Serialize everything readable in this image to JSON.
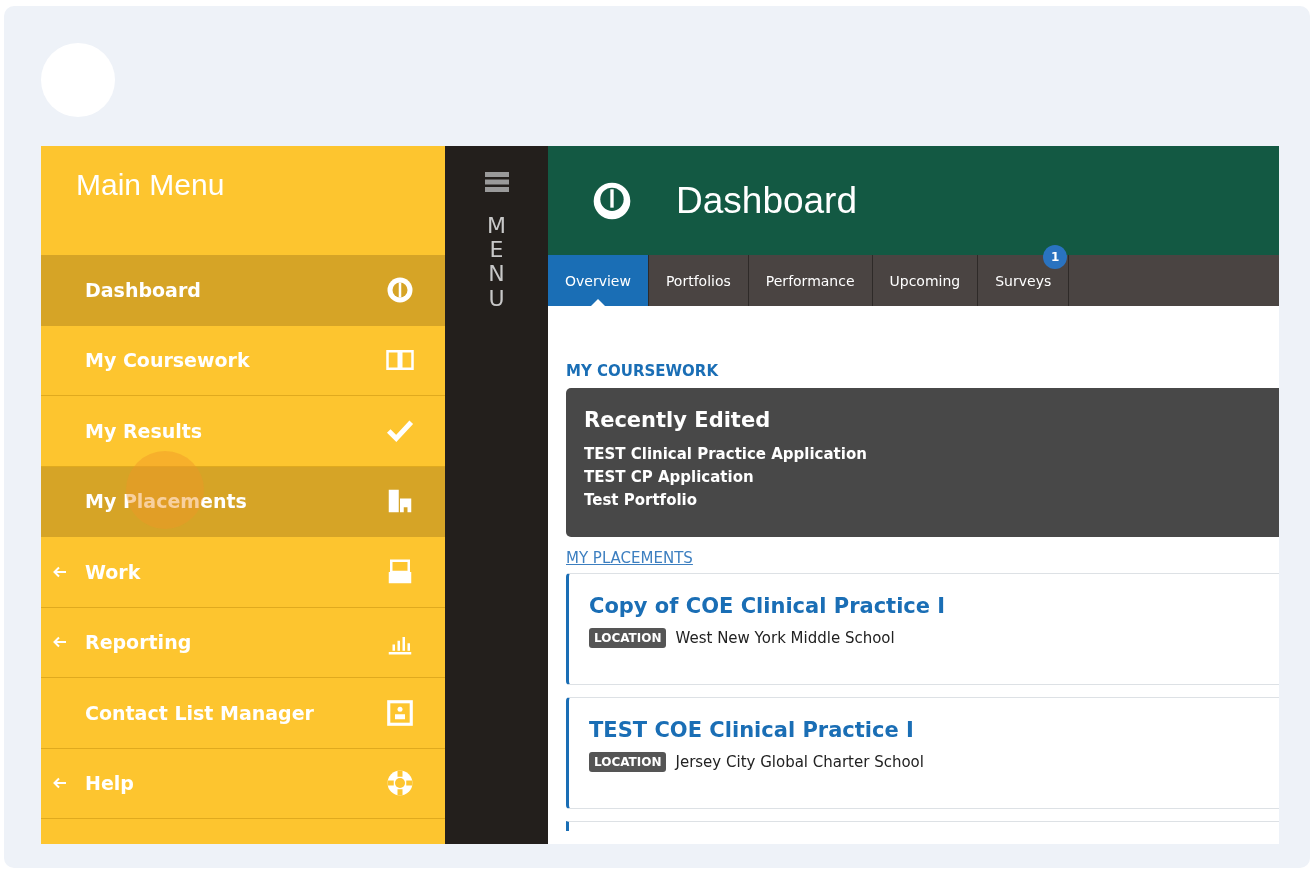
{
  "sidebar": {
    "title": "Main Menu",
    "items": [
      {
        "label": "Dashboard",
        "selected": true,
        "expandable": false
      },
      {
        "label": "My Coursework",
        "selected": false,
        "expandable": false
      },
      {
        "label": "My Results",
        "selected": false,
        "expandable": false
      },
      {
        "label": "My Placements",
        "selected": true,
        "expandable": false
      },
      {
        "label": "Work",
        "selected": false,
        "expandable": true
      },
      {
        "label": "Reporting",
        "selected": false,
        "expandable": true
      },
      {
        "label": "Contact List Manager",
        "selected": false,
        "expandable": false
      },
      {
        "label": "Help",
        "selected": false,
        "expandable": true
      }
    ]
  },
  "menu_strip": {
    "label": "MENU"
  },
  "header": {
    "title": "Dashboard"
  },
  "tabs": [
    {
      "label": "Overview",
      "selected": true
    },
    {
      "label": "Portfolios",
      "selected": false
    },
    {
      "label": "Performance",
      "selected": false
    },
    {
      "label": "Upcoming",
      "selected": false
    },
    {
      "label": "Surveys",
      "selected": false,
      "badge": "1"
    }
  ],
  "coursework": {
    "heading": "MY COURSEWORK",
    "card_title": "Recently Edited",
    "items": [
      "TEST Clinical Practice Application",
      "TEST CP Application",
      "Test Portfolio"
    ]
  },
  "placements": {
    "heading": "MY PLACEMENTS",
    "items": [
      {
        "title": "Copy of COE Clinical Practice I",
        "tag": "LOCATION",
        "location": "West New York Middle School"
      },
      {
        "title": "TEST COE Clinical Practice I",
        "tag": "LOCATION",
        "location": "Jersey City Global Charter School"
      }
    ]
  }
}
